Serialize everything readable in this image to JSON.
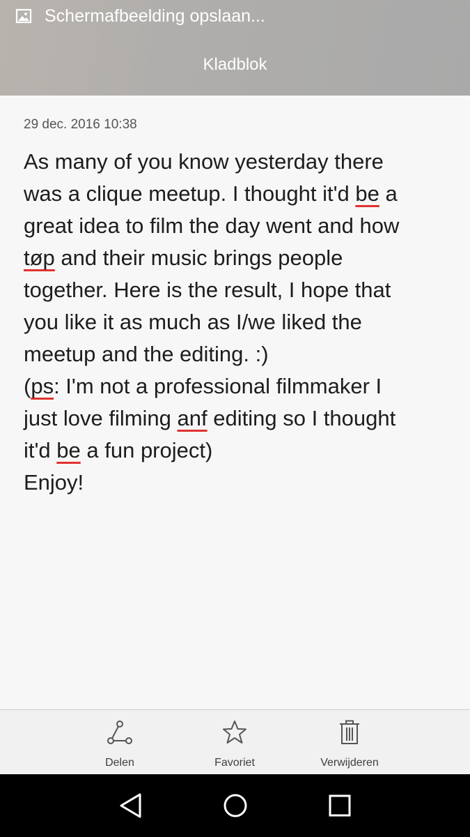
{
  "status_notification": {
    "icon": "image-icon",
    "text": "Schermafbeelding opslaan..."
  },
  "header": {
    "title": "Kladblok"
  },
  "note": {
    "timestamp": "29 dec. 2016 10:38",
    "lines": [
      "As many of you know yesterday there",
      "was a clique meetup. I thought it'd be a",
      "great idea to film the day went and how",
      "tøp and their music brings people",
      "together. Here is the result, I hope that",
      "you like it as much as I/we liked the",
      "meetup and the editing. :)",
      "(ps: I'm not a professional filmmaker I",
      "just love filming anf editing so I thought",
      "it'd be a fun project)",
      "Enjoy!"
    ],
    "spellcheck_flagged_words": [
      "be",
      "tøp",
      "ps",
      "anf",
      "be"
    ]
  },
  "toolbar": {
    "share": {
      "label": "Delen",
      "icon": "share-icon"
    },
    "favorite": {
      "label": "Favoriet",
      "icon": "star-icon"
    },
    "delete": {
      "label": "Verwijderen",
      "icon": "trash-icon"
    }
  },
  "navbar": {
    "back_icon": "back-triangle-icon",
    "home_icon": "home-circle-icon",
    "recents_icon": "recents-square-icon"
  },
  "colors": {
    "header_bg": "#adadad",
    "content_bg": "#f7f7f7",
    "toolbar_bg": "#f1f1f1",
    "navbar_bg": "#000000",
    "spellcheck_underline": "#e0322f"
  }
}
